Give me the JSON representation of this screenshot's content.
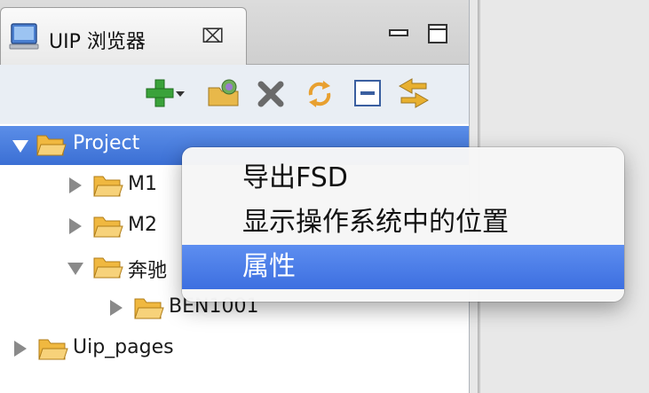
{
  "tab": {
    "title": "UIP 浏览器",
    "close_icon": "close-x-icon",
    "icon": "monitor-icon"
  },
  "view_controls": {
    "minimize_icon": "minimize-icon",
    "maximize_icon": "maximize-icon"
  },
  "toolbar": {
    "buttons": [
      {
        "name": "add-icon",
        "color": "#3aa23a"
      },
      {
        "name": "dropdown-arrow-icon"
      },
      {
        "name": "open-project-icon",
        "color": "#e8b84a"
      },
      {
        "name": "delete-icon",
        "color": "#6a6a6a"
      },
      {
        "name": "refresh-icon",
        "color": "#e8a030"
      },
      {
        "name": "collapse-all-icon",
        "color": "#3a5fa0"
      },
      {
        "name": "link-with-editor-icon",
        "color": "#e8b030"
      }
    ]
  },
  "tree": {
    "items": [
      {
        "label": "Project",
        "level": 0,
        "state": "expanded",
        "selected": true
      },
      {
        "label": "M1",
        "level": 1,
        "state": "collapsed"
      },
      {
        "label": "M2",
        "level": 1,
        "state": "collapsed"
      },
      {
        "label": "奔驰",
        "level": 1,
        "state": "expanded"
      },
      {
        "label": "BEN1001",
        "level": 2,
        "state": "collapsed"
      },
      {
        "label": "Uip_pages",
        "level": 0,
        "state": "collapsed"
      }
    ]
  },
  "context_menu": {
    "items": [
      {
        "label": "导出FSD",
        "highlighted": false
      },
      {
        "label": "显示操作系统中的位置",
        "highlighted": false
      },
      {
        "label": "属性",
        "highlighted": true
      }
    ]
  },
  "colors": {
    "selection": "#3b6fd4",
    "menu_highlight": "#3d6fe0",
    "folder": "#f0b840"
  }
}
